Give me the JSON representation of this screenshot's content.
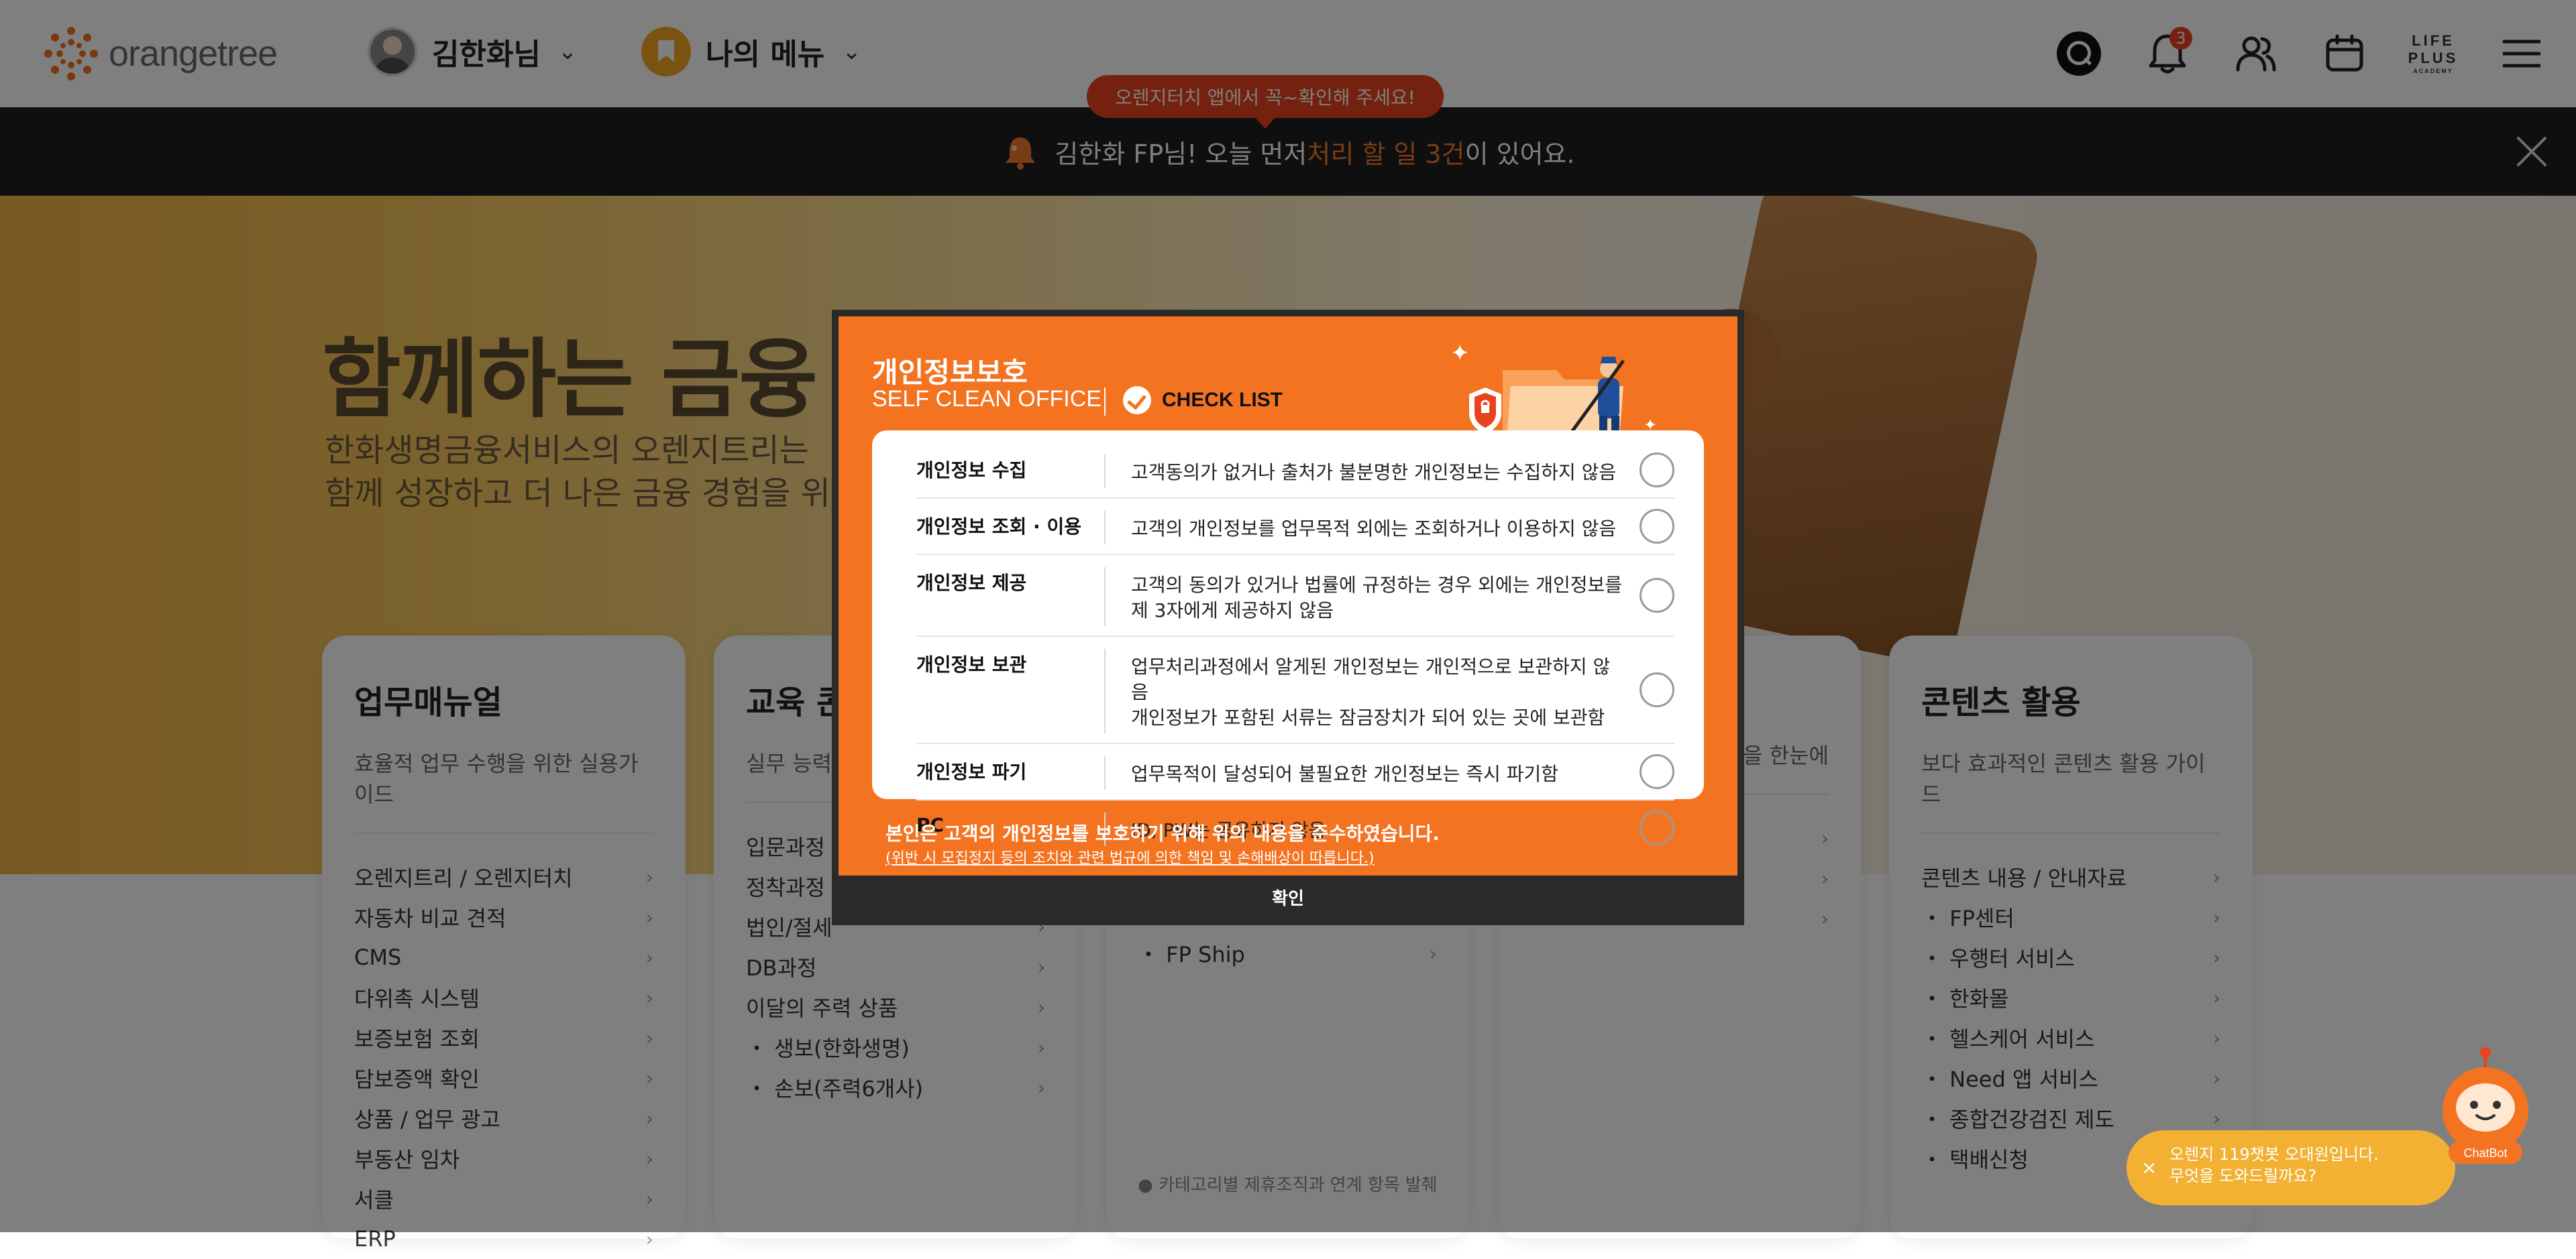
{
  "header": {
    "logo_text": "orangetree",
    "user_name": "김한화님",
    "my_menu": "나의 메뉴",
    "tooltip": "오렌지터치 앱에서 꼭~확인해 주세요!",
    "notification_count": "3",
    "lifeplus_lines": [
      "LIFE",
      "PLUS",
      "ACADEMY"
    ]
  },
  "notice": {
    "prefix": "김한화 FP님! 오늘 먼저 ",
    "highlight": "처리 할 일 3건",
    "suffix": "이 있어요."
  },
  "hero": {
    "title": "함께하는 금융",
    "sub1": "한화생명금융서비스의 오렌지트리는",
    "sub2": "함께 성장하고 더 나은 금융 경험을 위해"
  },
  "cards": [
    {
      "title": "업무매뉴얼",
      "sub": "효율적 업무 수행을 위한 실용가이드",
      "items": [
        "오렌지트리 / 오렌지터치",
        "자동차 비교 견적",
        "CMS",
        "다위촉 시스템",
        "보증보험 조회",
        "담보증액 확인",
        "상품 / 업무 광고",
        "부동산 임차",
        "서클",
        "ERP"
      ]
    },
    {
      "title": "교육 콘",
      "sub": "실무 능력 향",
      "items": [
        "입문과정",
        "정착과정",
        "법인/절세",
        "DB과정",
        "이달의 주력 상품",
        "・ 생보(한화생명)",
        "・ 손보(주력6개사)"
      ]
    },
    {
      "title": "",
      "sub": "",
      "items": [
        "",
        "",
        "",
        "・ FP Ship"
      ],
      "note": "● 카테고리별 제휴조직과 연계 항목 발췌"
    },
    {
      "title": "",
      "sub": "을 한눈에",
      "items": [
        "",
        "",
        ""
      ]
    },
    {
      "title": "콘텐츠 활용",
      "sub": "보다 효과적인 콘텐츠 활용 가이드",
      "items": [
        "콘텐츠 내용 / 안내자료",
        "・ FP센터",
        "・ 우행터 서비스",
        "・ 한화몰",
        "・ 헬스케어 서비스",
        "・ Need 앱 서비스",
        "・ 종합건강검진 제도",
        "・ 택배신청"
      ]
    }
  ],
  "modal": {
    "title": "개인정보보호",
    "subtitle": "SELF CLEAN OFFICE",
    "check_label": "CHECK LIST",
    "rows": [
      {
        "category": "개인정보 수집",
        "desc": "고객동의가 없거나 출처가 불분명한 개인정보는 수집하지 않음"
      },
      {
        "category": "개인정보 조회 · 이용",
        "desc": "고객의 개인정보를 업무목적 외에는 조회하거나 이용하지 않음"
      },
      {
        "category": "개인정보 제공",
        "desc": "고객의 동의가 있거나 법률에 규정하는 경우 외에는 개인정보를\n제 3자에게 제공하지 않음"
      },
      {
        "category": "개인정보 보관",
        "desc": "업무처리과정에서 알게된 개인정보는 개인적으로 보관하지 않음\n개인정보가 포함된 서류는 잠금장치가 되어 있는 곳에 보관함"
      },
      {
        "category": "개인정보 파기",
        "desc": "업무목적이 달성되어 불필요한 개인정보는 즉시 파기함"
      },
      {
        "category": "PC",
        "desc": "ID, PW는 공유하지 않음"
      }
    ],
    "agree_text": "본인은 고객의 개인정보를 보호하기 위해 위의 내용을 준수하였습니다.",
    "agree_note": "(위반 시 모집정지 등의 조치와 관련 법규에 의한 책임 및 손해배상이 따릅니다.)",
    "confirm": "확인"
  },
  "chatbot": {
    "line1": "오렌지 119챗봇 오대원입니다.",
    "line2": "무엇을 도와드릴까요?",
    "label": "ChatBot"
  },
  "colors": {
    "brand_orange": "#f37321",
    "alert_red": "#e8431e",
    "notice_bar": "#1f1f1f"
  }
}
